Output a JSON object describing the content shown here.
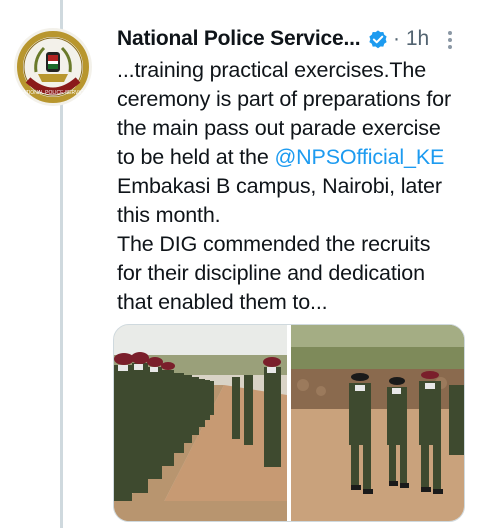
{
  "tweet": {
    "author_name": "National Police Service...",
    "separator": "·",
    "time": "1h",
    "avatar_icon": "police-crest-icon",
    "avatar_ring_text": "NATIONAL POLICE SERVICE",
    "verified_icon": "verified-badge-icon",
    "more_icon": "more-options-icon",
    "text_lines": [
      "...training practical exercises.The",
      "ceremony is part of preparations for",
      "the main pass out parade exercise",
      "to be held at the",
      "Embakasi B campus, Nairobi, later",
      "this month.",
      "The DIG commended the recruits",
      "for their discipline and dedication",
      "that enabled them to..."
    ],
    "mention": "@NPSOfficial_KE",
    "colors": {
      "link": "#1d9bf0",
      "text": "#0f1419",
      "muted": "#536471",
      "verified": "#1d9bf0"
    }
  }
}
